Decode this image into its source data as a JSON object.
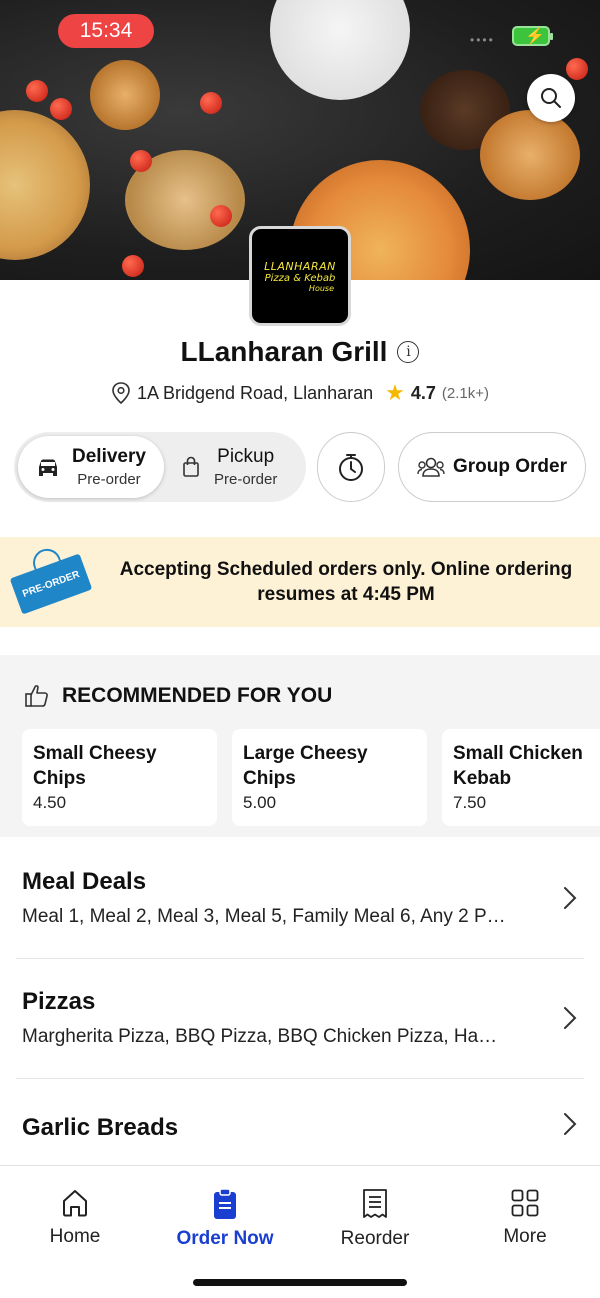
{
  "status_bar": {
    "time": "15:34"
  },
  "restaurant": {
    "logo_lines": [
      "LLANHARAN",
      "Pizza & Kebab",
      "House"
    ],
    "name": "LLanharan Grill",
    "address": "1A Bridgend Road, Llanharan",
    "rating": "4.7",
    "rating_count": "(2.1k+)"
  },
  "order_mode": {
    "delivery": {
      "label": "Delivery",
      "sub": "Pre-order"
    },
    "pickup": {
      "label": "Pickup",
      "sub": "Pre-order"
    },
    "group_order_label": "Group Order"
  },
  "banner": {
    "tag": "PRE-ORDER",
    "message": "Accepting Scheduled orders only. Online ordering resumes at 4:45 PM"
  },
  "recommended": {
    "heading": "RECOMMENDED FOR YOU",
    "items": [
      {
        "name": "Small Cheesy Chips",
        "price": "4.50"
      },
      {
        "name": "Large Cheesy Chips",
        "price": "5.00"
      },
      {
        "name": "Small Chicken Kebab",
        "price": "7.50"
      }
    ]
  },
  "categories": [
    {
      "title": "Meal Deals",
      "desc": "Meal 1, Meal 2, Meal 3, Meal 5, Family Meal 6, Any 2 P…"
    },
    {
      "title": "Pizzas",
      "desc": "Margherita Pizza, BBQ Pizza, BBQ Chicken Pizza, Ha…"
    },
    {
      "title": "Garlic Breads",
      "desc": ""
    }
  ],
  "tabbar": {
    "items": [
      {
        "label": "Home",
        "icon": "home-icon"
      },
      {
        "label": "Order Now",
        "icon": "order-icon"
      },
      {
        "label": "Reorder",
        "icon": "receipt-icon"
      },
      {
        "label": "More",
        "icon": "grid-icon"
      }
    ]
  },
  "colors": {
    "accent": "#1a3fd0",
    "status_pill": "#ef4444",
    "banner_bg": "#fdf1d6",
    "star": "#f5b800"
  }
}
